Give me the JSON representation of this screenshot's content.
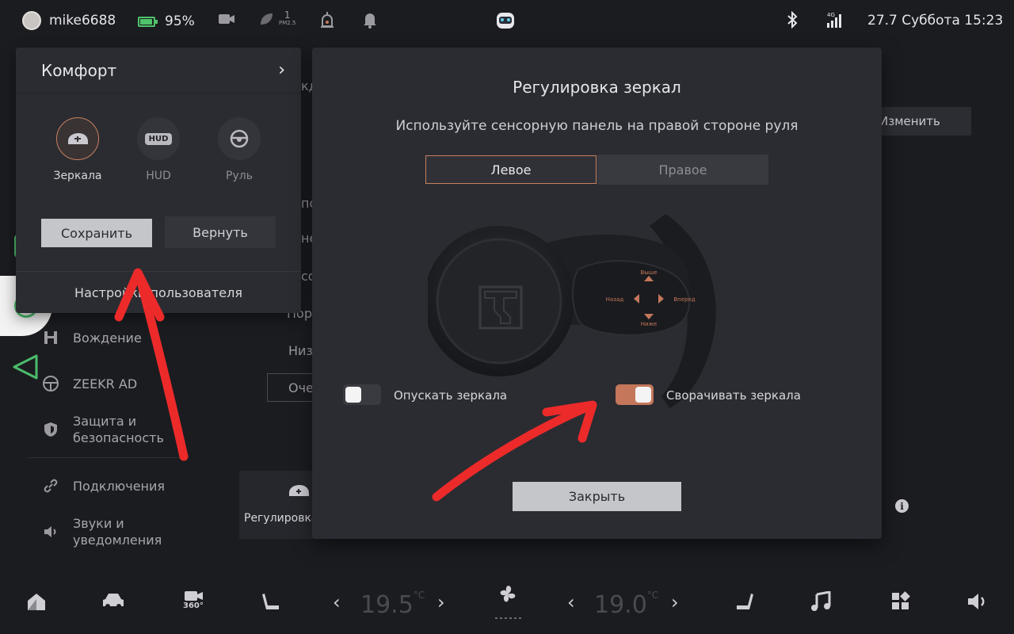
{
  "status_bar": {
    "username": "mike6688",
    "battery": "95%",
    "pm_value": "1",
    "pm_label": "PM2.5",
    "network": "4G",
    "datetime": "27.7 Суббота 15:23"
  },
  "background": {
    "button_change": "Изменить",
    "partial_labels": [
      "кд",
      "по",
      "не",
      "со",
      "Пор",
      "Низ"
    ],
    "outline_button": "Оче",
    "card_label": "Регулировка",
    "menu": [
      {
        "label": "Вождение",
        "icon": "drive-icon"
      },
      {
        "label": "ZEEKR AD",
        "icon": "steering-icon"
      },
      {
        "label": "Защита и безопасность",
        "icon": "shield-icon"
      },
      {
        "label": "Подключения",
        "icon": "link-icon"
      },
      {
        "label": "Звуки и уведомления",
        "icon": "speaker-icon"
      }
    ]
  },
  "comfort_panel": {
    "title": "Комфорт",
    "actions": [
      {
        "label": "Зеркала",
        "icon": "mirror-icon",
        "active": true
      },
      {
        "label": "HUD",
        "icon": "hud-icon",
        "active": false
      },
      {
        "label": "Руль",
        "icon": "steering-wheel-icon",
        "active": false
      }
    ],
    "hud_chip": "HUD",
    "save_label": "Сохранить",
    "return_label": "Вернуть",
    "user_settings_label": "Настройки пользователя"
  },
  "mirror_dialog": {
    "title": "Регулировка зеркал",
    "subtitle": "Используйте сенсорную панель на правой стороне руля",
    "segment_left": "Левое",
    "segment_right": "Правое",
    "dpad": {
      "up": "Выше",
      "down": "Ниже",
      "left": "Назад",
      "right": "Вперед"
    },
    "toggle_lower": {
      "label": "Опускать зеркала",
      "on": false
    },
    "toggle_fold": {
      "label": "Сворачивать зеркала",
      "on": true
    },
    "close_label": "Закрыть",
    "accent_color": "#c4775a"
  },
  "bottom_bar": {
    "temp_left": "19.5",
    "temp_right": "19.0",
    "temp_unit": "°C",
    "camera_label": "360°"
  }
}
